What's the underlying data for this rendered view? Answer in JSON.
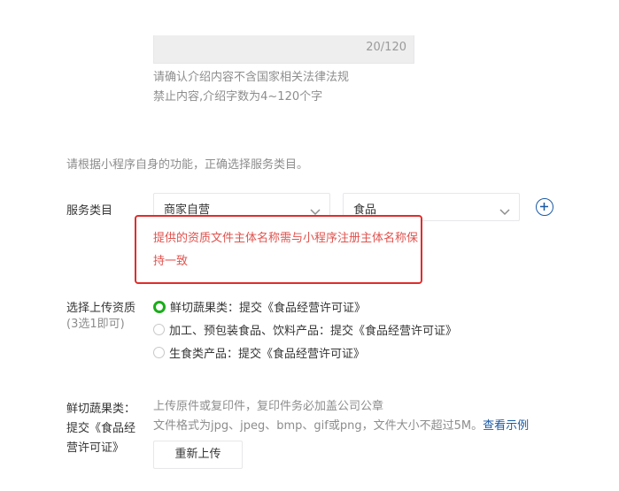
{
  "intro": {
    "counter": "20/120",
    "hint_line1": "请确认介绍内容不含国家相关法律法规",
    "hint_line2": "禁止内容,介绍字数为4~120个字"
  },
  "service": {
    "instruction": "请根据小程序自身的功能，正确选择服务类目。",
    "label": "服务类目",
    "primary_select": "商家自营",
    "secondary_select": "食品",
    "add_icon": "plus-circle-icon",
    "error_message": "提供的资质文件主体名称需与小程序注册主体名称保持一致"
  },
  "qualification": {
    "label": "选择上传资质",
    "sublabel": "(3选1即可)",
    "options": [
      {
        "label": "鲜切蔬果类：提交《食品经营许可证》",
        "checked": true
      },
      {
        "label": "加工、预包装食品、饮料产品：提交《食品经营许可证》",
        "checked": false
      },
      {
        "label": "生食类产品：提交《食品经营许可证》",
        "checked": false
      }
    ]
  },
  "upload": {
    "label_line1": "鲜切蔬果类：",
    "label_line2": "提交《食品经",
    "label_line3": "营许可证》",
    "hint_line1": "上传原件或复印件，复印件务必加盖公司公章",
    "hint_line2": "文件格式为jpg、jpeg、bmp、gif或png，文件大小不超过5M。",
    "example_link": "查看示例",
    "reupload_button": "重新上传"
  },
  "colors": {
    "accent_green": "#1aad19",
    "error_red": "#e0524d",
    "error_border": "#e02d2d",
    "link_blue": "#1a5aa6"
  }
}
